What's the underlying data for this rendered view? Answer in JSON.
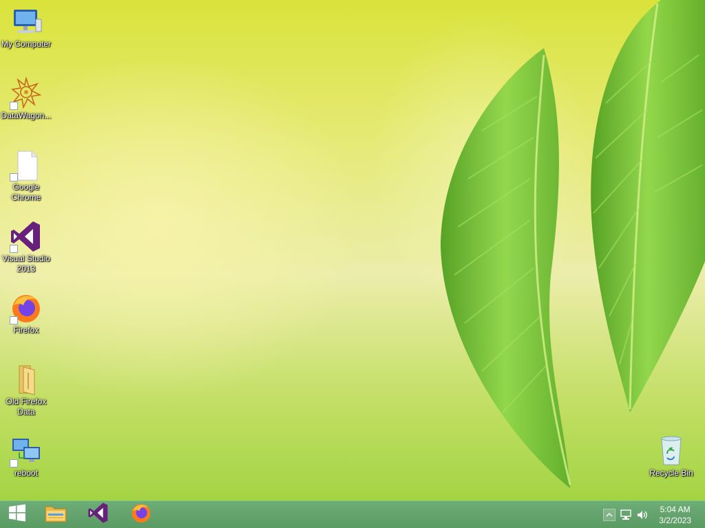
{
  "desktop": {
    "icons": [
      {
        "label": "My Computer",
        "icon": "computer-icon",
        "shortcut": false
      },
      {
        "label": "DataWagon...",
        "icon": "datawagon-icon",
        "shortcut": true
      },
      {
        "label": "Google Chrome",
        "icon": "document-icon",
        "shortcut": true
      },
      {
        "label": "Visual Studio 2013",
        "icon": "visual-studio-icon",
        "shortcut": true
      },
      {
        "label": "Firefox",
        "icon": "firefox-icon",
        "shortcut": true
      },
      {
        "label": "Old Firefox Data",
        "icon": "folder-icon",
        "shortcut": false
      },
      {
        "label": "reboot",
        "icon": "network-computers-icon",
        "shortcut": true
      },
      {
        "label": "Recycle Bin",
        "icon": "recycle-bin-icon",
        "shortcut": false
      }
    ]
  },
  "taskbar": {
    "pinned": [
      {
        "icon": "windows-start-icon"
      },
      {
        "icon": "file-explorer-icon"
      },
      {
        "icon": "visual-studio-icon"
      },
      {
        "icon": "firefox-icon"
      }
    ],
    "tray": {
      "icons": [
        "show-hidden-icons-chevron",
        "network-icon",
        "volume-icon"
      ],
      "time": "5:04 AM",
      "date": "3/2/2023"
    }
  },
  "colors": {
    "taskbar": "#5f9f68",
    "wallpaper_primary": "#d9e33a",
    "leaf_green": "#6cc23a",
    "label_text": "#ffffff"
  }
}
